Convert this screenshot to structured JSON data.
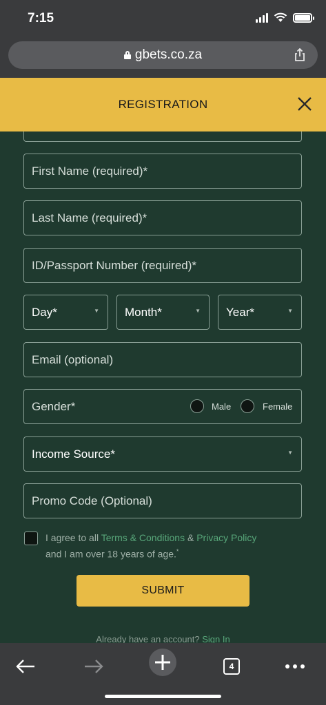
{
  "status_bar": {
    "time": "7:15"
  },
  "browser": {
    "url": "gbets.co.za",
    "tab_count": "4"
  },
  "header": {
    "title": "REGISTRATION"
  },
  "form": {
    "first_name_placeholder": "First Name (required)*",
    "last_name_placeholder": "Last Name (required)*",
    "id_placeholder": "ID/Passport Number (required)*",
    "day_label": "Day*",
    "month_label": "Month*",
    "year_label": "Year*",
    "email_placeholder": "Email (optional)",
    "gender_label": "Gender*",
    "gender_male": "Male",
    "gender_female": "Female",
    "income_label": "Income Source*",
    "promo_placeholder": "Promo Code (Optional)",
    "terms_prefix": "I agree to all ",
    "terms_link": "Terms & Conditions",
    "terms_amp": " & ",
    "privacy_link": "Privacy Policy",
    "terms_suffix": "and I am over 18 years of age.",
    "terms_asterisk": "*",
    "submit_label": "SUBMIT",
    "already_text": "Already have an account? ",
    "sign_in_link": "Sign In"
  },
  "colors": {
    "accent": "#e8bb45",
    "background": "#1f3a2f",
    "link": "#58a77a",
    "chrome": "#3a3b3d"
  }
}
